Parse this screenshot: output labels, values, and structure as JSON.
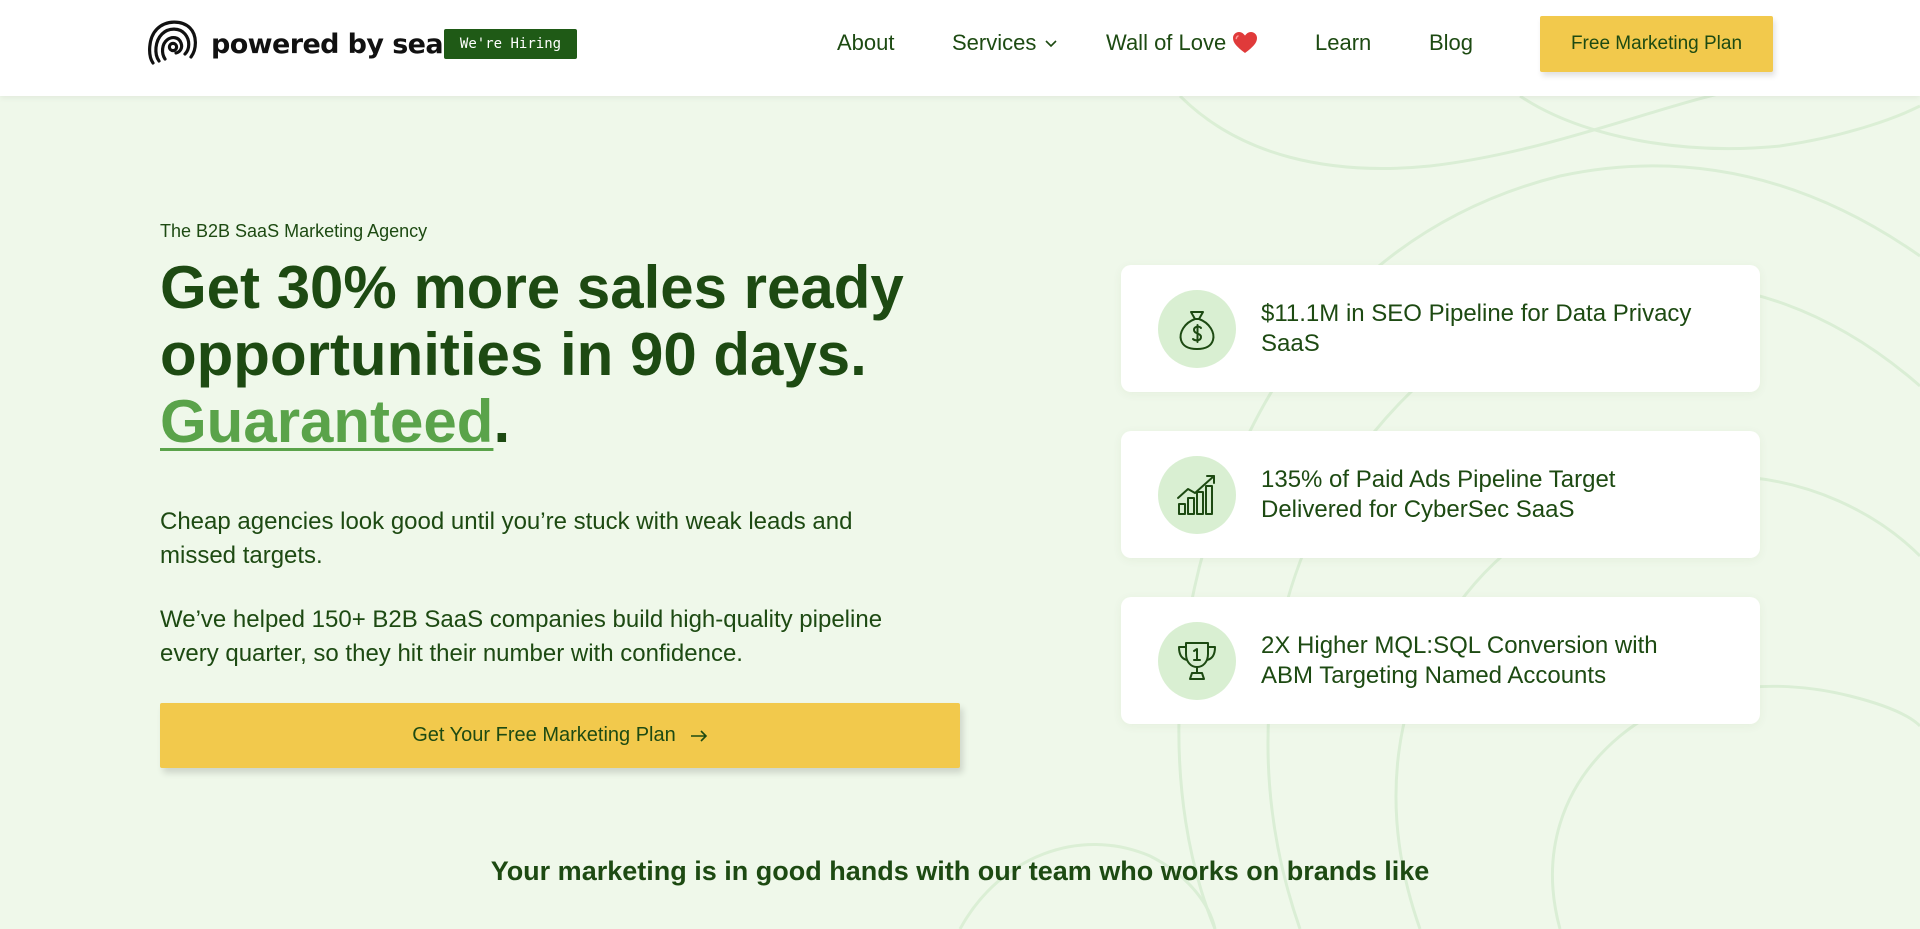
{
  "header": {
    "logo_text": "powered by search",
    "hiring_badge": "We're Hiring",
    "nav": {
      "about": "About",
      "services": "Services",
      "wall_of_love": "Wall of Love",
      "learn": "Learn",
      "blog": "Blog"
    },
    "cta_label": "Free Marketing Plan"
  },
  "hero": {
    "eyebrow": "The B2B SaaS Marketing Agency",
    "headline_line1": "Get 30% more sales ready opportunities in 90 days.",
    "headline_highlight": "Guaranteed",
    "headline_period": ".",
    "paragraph1": "Cheap agencies look good until you’re stuck with weak leads and missed targets.",
    "paragraph2": "We’ve helped 150+ B2B SaaS companies build high-quality pipeline every quarter, so they hit their number with confidence.",
    "cta_label": "Get Your Free Marketing Plan"
  },
  "stats": [
    {
      "icon": "money-bag-icon",
      "text": "$11.1M in SEO Pipeline for Data Privacy SaaS"
    },
    {
      "icon": "growth-chart-icon",
      "text": "135% of Paid Ads Pipeline Target Delivered for CyberSec SaaS"
    },
    {
      "icon": "trophy-icon",
      "text": "2X Higher MQL:SQL Conversion with ABM Targeting Named Accounts"
    }
  ],
  "brands_heading": "Your marketing is in good hands with our team who works on brands like",
  "colors": {
    "brand_green": "#1d4a12",
    "accent_green": "#5aa34a",
    "cta_yellow": "#f2c94c",
    "badge_green": "#1f5a16",
    "hero_bg": "#eff8ea",
    "icon_circle_bg": "#d9efd2"
  }
}
